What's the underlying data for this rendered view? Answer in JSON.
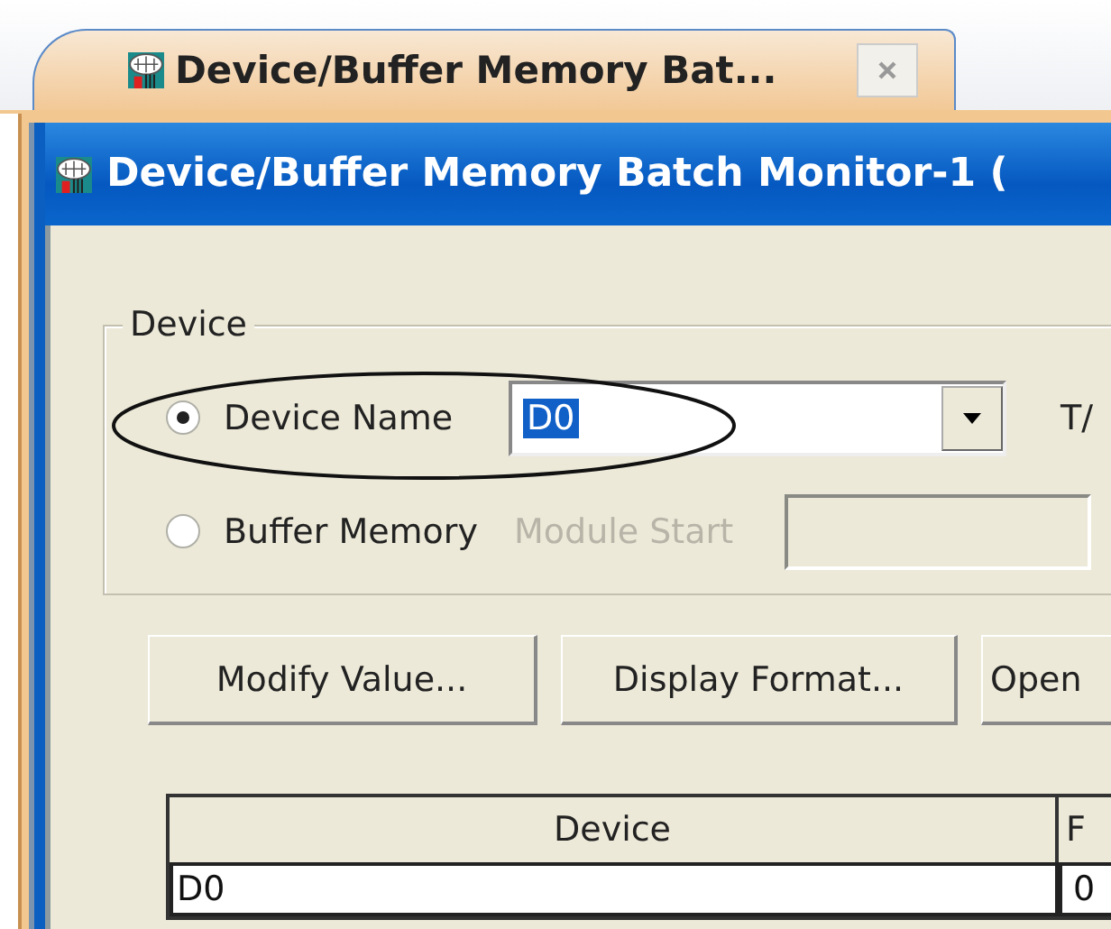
{
  "tab": {
    "title": "Device/Buffer Memory Bat...",
    "selected": true
  },
  "window": {
    "title": "Device/Buffer Memory Batch Monitor-1 ("
  },
  "device_group": {
    "title": "Device",
    "options": [
      {
        "kind": "combo",
        "label": "Device Name",
        "selected": true,
        "value": "D0",
        "side_label": "T/"
      },
      {
        "kind": "field",
        "label": "Buffer Memory",
        "selected": false,
        "field_label": "Module Start",
        "field_disabled": true
      }
    ]
  },
  "buttons": [
    "Modify Value...",
    "Display Format...",
    "Open"
  ],
  "table": {
    "columns": [
      "Device",
      "F"
    ],
    "rows": [
      [
        "D0",
        "0"
      ]
    ]
  }
}
